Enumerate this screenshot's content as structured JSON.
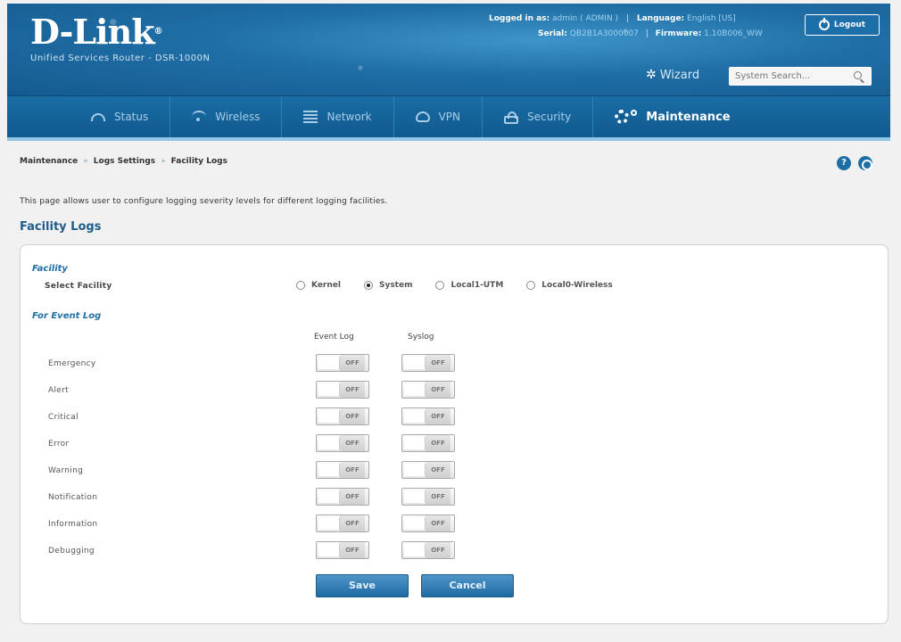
{
  "header": {
    "logo": "D-Link",
    "product": "Unified Services Router - DSR-1000N",
    "logged_in_label": "Logged in as:",
    "logged_in_value": "admin ( ADMIN )",
    "language_label": "Language:",
    "language_value": "English [US]",
    "serial_label": "Serial:",
    "serial_value": "QB2B1A3000007",
    "firmware_label": "Firmware:",
    "firmware_value": "1.10B006_WW",
    "logout_label": "Logout",
    "wizard_label": "Wizard",
    "search_placeholder": "System Search..."
  },
  "nav": [
    {
      "label": "Status",
      "icon": "gauge-icon"
    },
    {
      "label": "Wireless",
      "icon": "wifi-icon"
    },
    {
      "label": "Network",
      "icon": "network-icon"
    },
    {
      "label": "VPN",
      "icon": "vpn-icon"
    },
    {
      "label": "Security",
      "icon": "lock-icon"
    },
    {
      "label": "Maintenance",
      "icon": "gear-icon",
      "active": true
    }
  ],
  "breadcrumb": [
    "Maintenance",
    "Logs Settings",
    "Facility Logs"
  ],
  "page": {
    "description": "This page allows user to configure logging severity levels for different logging facilities.",
    "title": "Facility Logs"
  },
  "facility": {
    "group_label": "Facility",
    "select_label": "Select Facility",
    "options": [
      "Kernel",
      "System",
      "Local1-UTM",
      "Local0-Wireless"
    ],
    "selected": "System"
  },
  "event_log": {
    "group_label": "For Event Log",
    "col_event_log": "Event Log",
    "col_syslog": "Syslog",
    "toggle_off_text": "OFF",
    "rows": [
      "Emergency",
      "Alert",
      "Critical",
      "Error",
      "Warning",
      "Notification",
      "Information",
      "Debugging"
    ]
  },
  "buttons": {
    "save": "Save",
    "cancel": "Cancel"
  },
  "colors": {
    "header_blue": "#1f6ea6",
    "accent_blue": "#1f6ea6"
  }
}
